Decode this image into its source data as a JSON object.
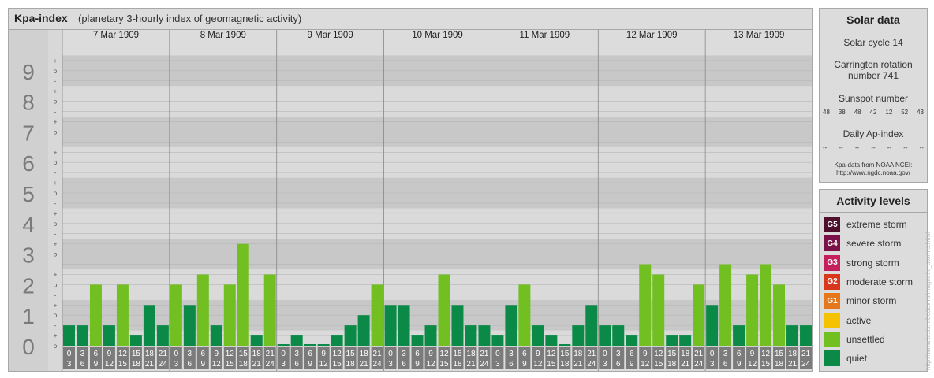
{
  "header": {
    "title": "Kpa-index",
    "subtitle": "(planetary 3-hourly index of geomagnetic activity)"
  },
  "chart_data": {
    "type": "bar",
    "ylim": [
      0,
      9
    ],
    "y_major_labels": [
      "0",
      "1",
      "2",
      "3",
      "4",
      "5",
      "6",
      "7",
      "8",
      "9"
    ],
    "sub_tick_labels": [
      "-",
      "o",
      "+"
    ],
    "days": [
      "7 Mar 1909",
      "8 Mar 1909",
      "9 Mar 1909",
      "10 Mar 1909",
      "11 Mar 1909",
      "12 Mar 1909",
      "13 Mar 1909"
    ],
    "interval_labels": [
      [
        "0",
        "3"
      ],
      [
        "3",
        "6"
      ],
      [
        "6",
        "9"
      ],
      [
        "9",
        "12"
      ],
      [
        "12",
        "15"
      ],
      [
        "15",
        "18"
      ],
      [
        "18",
        "21"
      ],
      [
        "21",
        "24"
      ]
    ],
    "values": [
      [
        0.667,
        0.667,
        2.0,
        0.667,
        2.0,
        0.333,
        1.333,
        0.667
      ],
      [
        2.0,
        1.333,
        2.333,
        0.667,
        2.0,
        3.333,
        0.333,
        2.333
      ],
      [
        0.0,
        0.333,
        0.0,
        0.0,
        0.333,
        0.667,
        1.0,
        2.0
      ],
      [
        1.333,
        1.333,
        0.333,
        0.667,
        2.333,
        1.333,
        0.667,
        0.667
      ],
      [
        0.333,
        1.333,
        2.0,
        0.667,
        0.333,
        0.0,
        0.667,
        1.333
      ],
      [
        0.667,
        0.667,
        0.333,
        2.667,
        2.333,
        0.333,
        0.333,
        2.0
      ],
      [
        1.333,
        2.667,
        0.667,
        2.333,
        2.667,
        2.0,
        0.667,
        0.667
      ]
    ],
    "colors": {
      "quiet": "#0a8a46",
      "unsettled": "#72bf22"
    }
  },
  "solar": {
    "title": "Solar data",
    "cycle": "Solar cycle 14",
    "carrington_1": "Carrington rotation",
    "carrington_2": "number 741",
    "sunspot_title": "Sunspot number",
    "sunspots": [
      "48",
      "38",
      "48",
      "42",
      "12",
      "52",
      "43"
    ],
    "ap_title": "Daily Ap-index",
    "ap": [
      "--",
      "--",
      "--",
      "--",
      "--",
      "--",
      "--"
    ],
    "credit_1": "Kpa-data from NOAA NCEI:",
    "credit_2": "http://www.ngdc.noaa.gov/"
  },
  "levels": {
    "title": "Activity levels",
    "items": [
      {
        "code": "G5",
        "label": "extreme storm",
        "color": "#4d0f2c"
      },
      {
        "code": "G4",
        "label": "severe storm",
        "color": "#7a1248"
      },
      {
        "code": "G3",
        "label": "strong storm",
        "color": "#c4205e"
      },
      {
        "code": "G2",
        "label": "moderate storm",
        "color": "#d8371c"
      },
      {
        "code": "G1",
        "label": "minor storm",
        "color": "#e5781c"
      },
      {
        "code": "",
        "label": "active",
        "color": "#f4c200"
      },
      {
        "code": "",
        "label": "unsettled",
        "color": "#72bf22"
      },
      {
        "code": "",
        "label": "quiet",
        "color": "#0a8a46"
      }
    ]
  },
  "watermark": "http://www.tesis.lebedev.ru/magnetic_storms.html"
}
